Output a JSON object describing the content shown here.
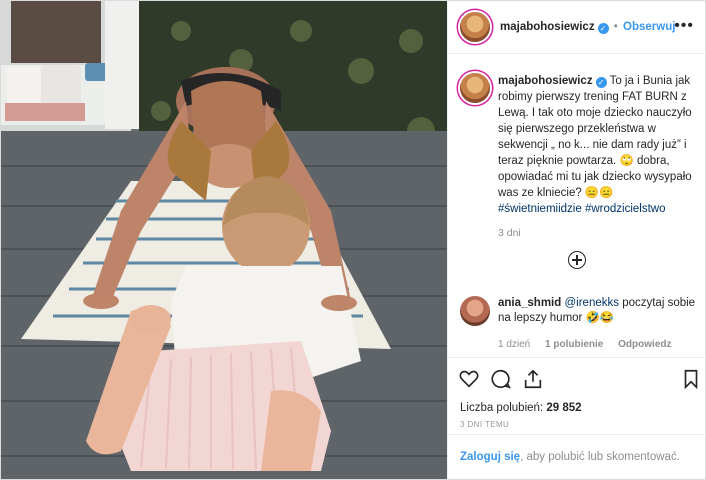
{
  "header": {
    "username": "majabohosiewicz",
    "verified_symbol": "✓",
    "separator": "•",
    "follow_label": "Obserwuj",
    "more_symbol": "•••"
  },
  "photo": {
    "icon": "post-photo"
  },
  "caption": {
    "username": "majabohosiewicz",
    "text": "To ja i Bunia jak robimy pierwszy trening FAT BURN z Lewą. I tak oto moje dziecko nauczyło się pierwszego przekleństwa w sekwencji „ no k... nie dam rady już” i teraz pięknie powtarza. 🙄 dobra, opowiadać mi tu jak dziecko wysypało was ze klniecie? 😑😑",
    "hashtag1": "#świetniemiidzie",
    "hashtag2": "#wrodzicielstwo",
    "time": "3 dni"
  },
  "load_more_icon": "plus-circle-icon",
  "comment": {
    "username": "ania_shmid",
    "mention": "@irenekks",
    "text": "poczytaj sobie na lepszy humor 🤣😂",
    "time": "1 dzień",
    "likes": "1 polubienie",
    "reply": "Odpowiedz"
  },
  "actions": {
    "likes_label": "Liczba polubień:",
    "likes_count": "29 852",
    "posted_ago": "3 DNI TEMU"
  },
  "login": {
    "link": "Zaloguj się",
    "rest": ", aby polubić lub skomentować."
  },
  "colors": {
    "accent": "#3897f0",
    "hashtag": "#003569",
    "muted": "#8e8e8e",
    "border": "#efefef"
  }
}
